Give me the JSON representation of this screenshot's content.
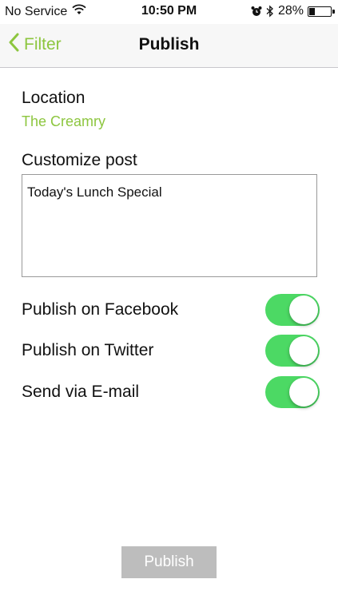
{
  "status_bar": {
    "carrier": "No Service",
    "time": "10:50 PM",
    "battery_text": "28%",
    "battery_level": 0.28,
    "icons": [
      "wifi-icon",
      "alarm-clock-icon",
      "bluetooth-icon",
      "battery-icon"
    ]
  },
  "nav": {
    "back_label": "Filter",
    "title": "Publish",
    "back_icon": "chevron-left-icon"
  },
  "location": {
    "label": "Location",
    "value": "The Creamry"
  },
  "customize": {
    "label": "Customize post",
    "text": "Today's Lunch Special"
  },
  "options": [
    {
      "label": "Publish on Facebook",
      "enabled": true
    },
    {
      "label": "Publish on Twitter",
      "enabled": true
    },
    {
      "label": "Send via E-mail",
      "enabled": true
    }
  ],
  "publish_button": {
    "label": "Publish",
    "enabled": false
  },
  "colors": {
    "accent": "#8dc63f",
    "switch_on": "#4cd964",
    "button_disabled": "#bdbdbd",
    "nav_background": "#f7f7f7"
  }
}
